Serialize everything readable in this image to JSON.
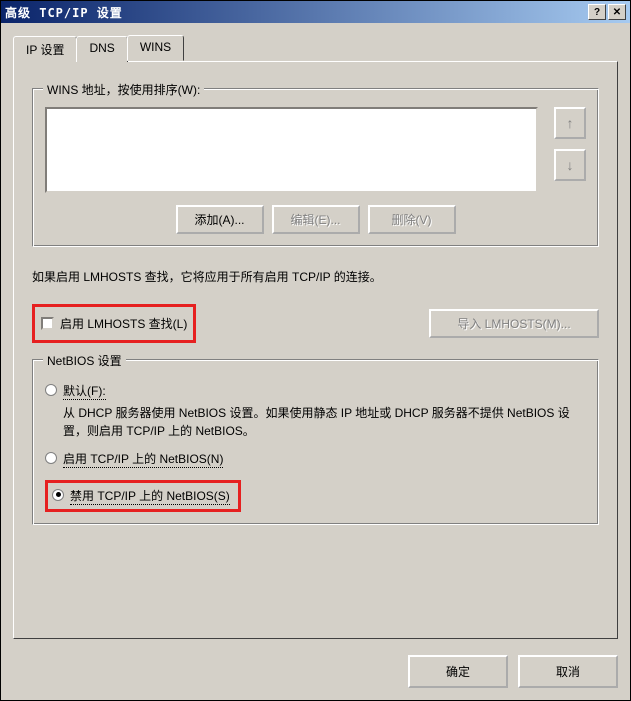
{
  "title": "高级 TCP/IP 设置",
  "tabs": {
    "ip": "IP 设置",
    "dns": "DNS",
    "wins": "WINS"
  },
  "wins": {
    "group_title": "WINS 地址，按使用排序(W):",
    "add": "添加(A)...",
    "edit": "编辑(E)...",
    "remove": "删除(V)"
  },
  "lmhosts_info": "如果启用 LMHOSTS 查找，它将应用于所有启用 TCP/IP 的连接。",
  "enable_lmhosts": "启用 LMHOSTS 查找(L)",
  "import_lmhosts": "导入 LMHOSTS(M)...",
  "netbios": {
    "title": "NetBIOS 设置",
    "default_label": "默认(F):",
    "default_desc": "从 DHCP 服务器使用 NetBIOS 设置。如果使用静态 IP 地址或 DHCP 服务器不提供 NetBIOS 设置，则启用 TCP/IP 上的 NetBIOS。",
    "enable": "启用 TCP/IP 上的 NetBIOS(N)",
    "disable": "禁用 TCP/IP 上的 NetBIOS(S)"
  },
  "buttons": {
    "ok": "确定",
    "cancel": "取消"
  }
}
